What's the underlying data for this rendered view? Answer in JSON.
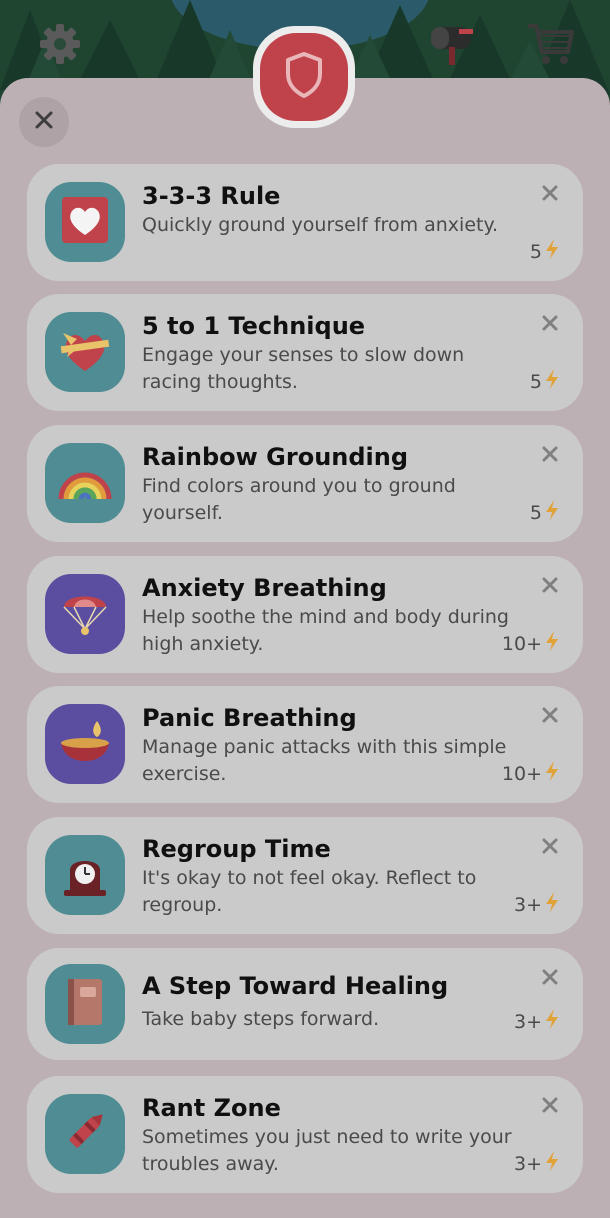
{
  "header": {
    "settings_icon": "gear-icon",
    "mail_icon": "mailbox-icon",
    "shop_icon": "cart-icon",
    "badge_icon": "shield-icon",
    "close_icon": "close-icon"
  },
  "colors": {
    "panel": "#bcb0b4",
    "card": "#cbcaca",
    "badge": "#c0424a",
    "bolt": "#e0a33a",
    "thumb_teal": "#4f8c93",
    "thumb_purple": "#5b4ea0"
  },
  "exercises": [
    {
      "title": "3-3-3 Rule",
      "description": "Quickly ground yourself from anxiety.",
      "cost": "5",
      "icon": "heart-icon"
    },
    {
      "title": "5 to 1 Technique",
      "description": "Engage your senses to slow down racing thoughts.",
      "cost": "5",
      "icon": "heart-gift-icon"
    },
    {
      "title": "Rainbow Grounding",
      "description": "Find colors around you to ground yourself.",
      "cost": "5",
      "icon": "rainbow-icon"
    },
    {
      "title": "Anxiety Breathing",
      "description": "Help soothe the mind and body during high anxiety.",
      "cost": "10+",
      "icon": "parachute-icon"
    },
    {
      "title": "Panic Breathing",
      "description": "Manage panic attacks with this simple exercise.",
      "cost": "10+",
      "icon": "oil-lamp-icon"
    },
    {
      "title": "Regroup Time",
      "description": "It's okay to not feel okay. Reflect to regroup.",
      "cost": "3+",
      "icon": "clock-icon"
    },
    {
      "title": "A Step Toward Healing",
      "description": "Take baby steps forward.",
      "cost": "3+",
      "icon": "book-icon"
    },
    {
      "title": "Rant Zone",
      "description": "Sometimes you just need to write your troubles away.",
      "cost": "3+",
      "icon": "crayon-icon"
    }
  ]
}
